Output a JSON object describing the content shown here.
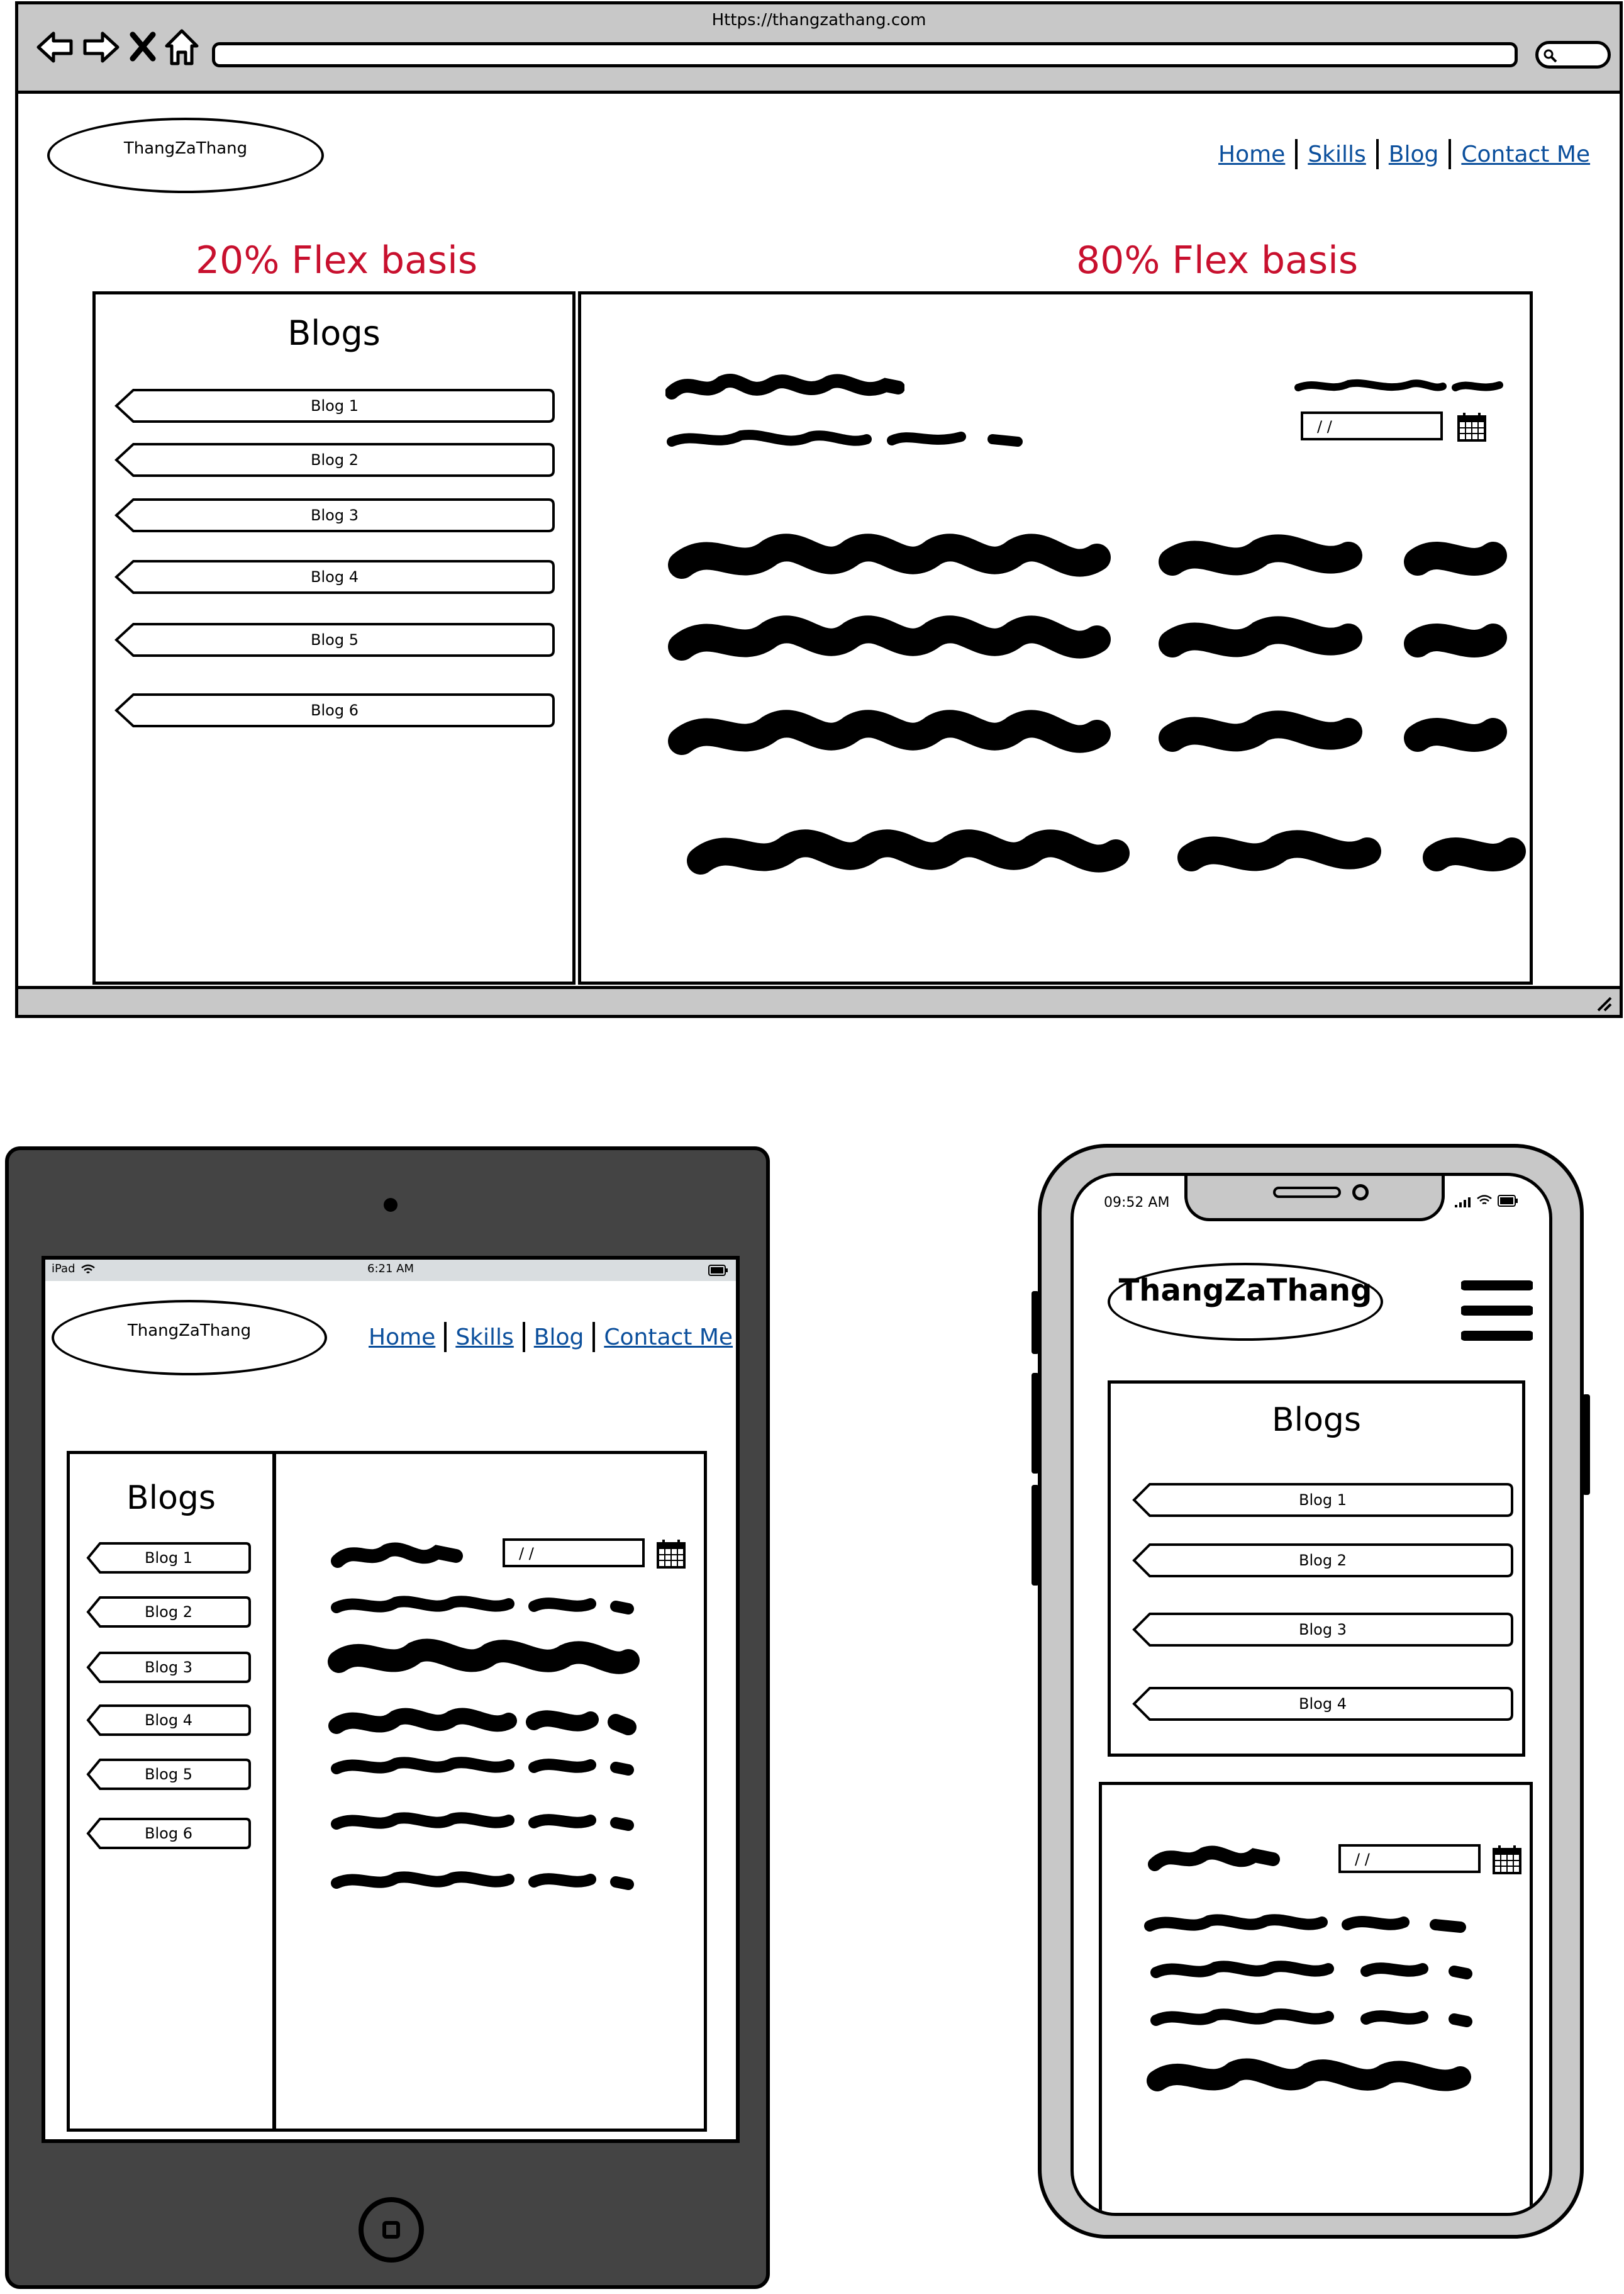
{
  "browser": {
    "url": "Https://thangzathang.com"
  },
  "brand": {
    "logo_text": "ThangZaThang"
  },
  "nav": {
    "home": "Home",
    "skills": "Skills",
    "blog": "Blog",
    "contact": "Contact Me"
  },
  "annotations": {
    "left": "20% Flex basis",
    "right": "80% Flex basis"
  },
  "sidebar": {
    "title": "Blogs",
    "items": [
      "Blog 1",
      "Blog 2",
      "Blog 3",
      "Blog 4",
      "Blog 5",
      "Blog 6"
    ]
  },
  "date_input": {
    "value": "/ /"
  },
  "ipad": {
    "carrier": "iPad",
    "time": "6:21 AM"
  },
  "phone": {
    "time": "09:52 AM"
  },
  "colors": {
    "annotation_red": "#c8102e",
    "link_blue": "#0b4f9c",
    "chrome_gray": "#c8c8c8",
    "tablet_body": "#444444",
    "phone_bezel": "#c8c8c8"
  }
}
